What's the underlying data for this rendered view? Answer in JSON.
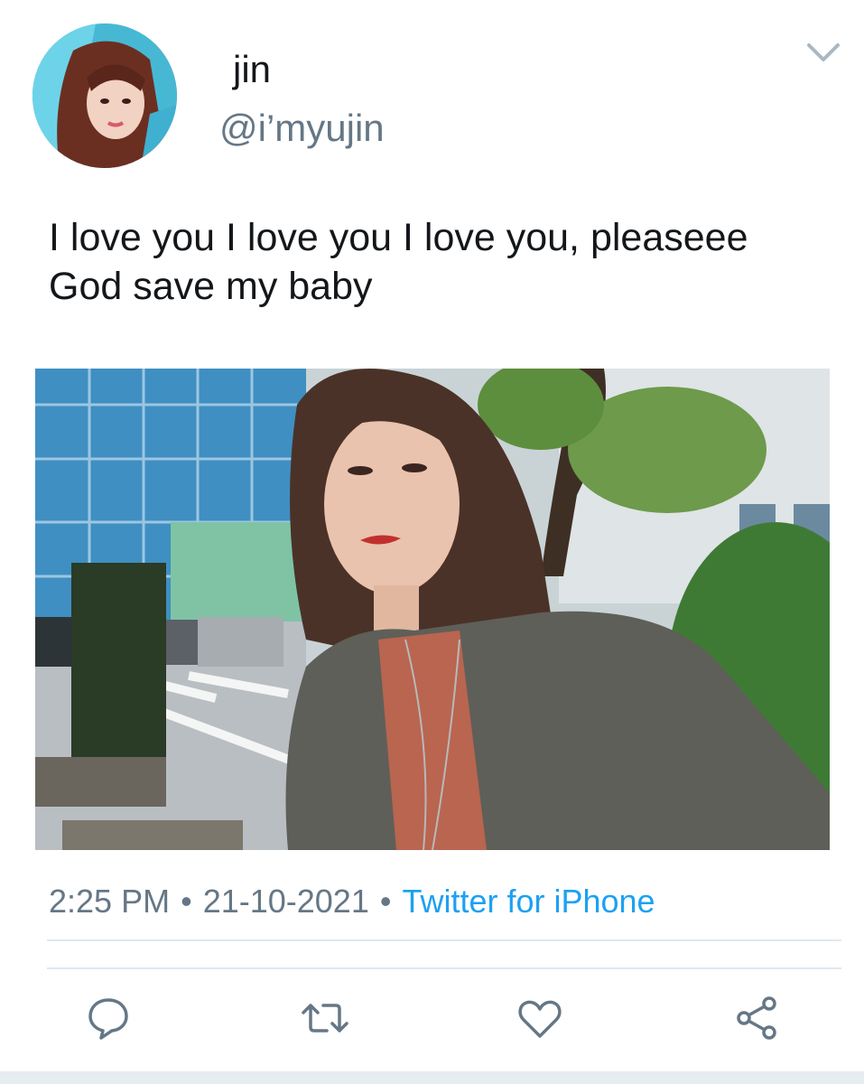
{
  "user": {
    "display_name": "jin",
    "handle": "@i’myujin",
    "avatar_icon": "profile-avatar"
  },
  "tweet": {
    "text_lines": [
      "I love you I love you I love you, pleaseee",
      "God save my baby"
    ],
    "time": "2:25 PM",
    "date": "21-10-2021",
    "separator": "•",
    "source": "Twitter for iPhone"
  },
  "actions": [
    {
      "icon": "reply-icon"
    },
    {
      "icon": "retweet-icon"
    },
    {
      "icon": "like-icon"
    },
    {
      "icon": "share-icon"
    }
  ],
  "colors": {
    "text": "#14171a",
    "secondary": "#657786",
    "accent": "#1da1f2",
    "divider": "#e1e8ed"
  }
}
